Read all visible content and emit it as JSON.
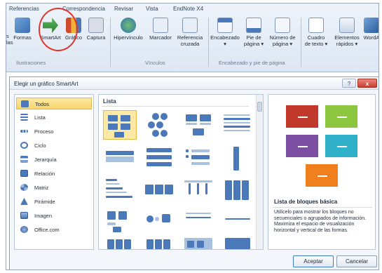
{
  "ribbon": {
    "tabs": [
      "Referencias",
      "Correspondencia",
      "Revisar",
      "Vista",
      "EndNote X4"
    ],
    "buttons": [
      {
        "label": "Formas",
        "label2": "",
        "icon": "shapes-icon"
      },
      {
        "label": "SmartArt",
        "label2": "",
        "icon": "smartart-icon"
      },
      {
        "label": "Gráfico",
        "label2": "",
        "icon": "chart-icon"
      },
      {
        "label": "Captura",
        "label2": "",
        "icon": "screenshot-icon"
      },
      {
        "label": "Hipervínculo",
        "label2": "",
        "icon": "hyperlink-icon"
      },
      {
        "label": "Marcador",
        "label2": "",
        "icon": "bookmark-icon"
      },
      {
        "label": "Referencia",
        "label2": "cruzada",
        "icon": "cross-reference-icon"
      },
      {
        "label": "Encabezado",
        "label2": "▾",
        "icon": "header-icon"
      },
      {
        "label": "Pie de",
        "label2": "página ▾",
        "icon": "footer-icon"
      },
      {
        "label": "Número de",
        "label2": "página ▾",
        "icon": "page-number-icon"
      },
      {
        "label": "Cuadro",
        "label2": "de texto ▾",
        "icon": "textbox-icon"
      },
      {
        "label": "Elementos",
        "label2": "rápidos ▾",
        "icon": "quick-parts-icon"
      },
      {
        "label": "WordA",
        "label2": "",
        "icon": "wordart-icon"
      }
    ],
    "left_fragments": [
      "s",
      "las"
    ],
    "groups": [
      "Ilustraciones",
      "Vínculos",
      "Encabezado y pie de página"
    ]
  },
  "dialog": {
    "title": "Elegir un gráfico SmartArt",
    "help": "?",
    "close": "x",
    "categories": [
      "Todos",
      "Lista",
      "Proceso",
      "Ciclo",
      "Jerarquía",
      "Relación",
      "Matriz",
      "Pirámide",
      "Imagen",
      "Office.com"
    ],
    "selected_category": "Todos",
    "gallery_header": "Lista",
    "preview_title": "Lista de bloques básica",
    "preview_desc": [
      "Utilícelo para mostrar los bloques no",
      "secuenciales o agrupados de información.",
      "Maximiza el espacio de visualización",
      "horizontal y vertical de las formas."
    ],
    "ok": "Aceptar",
    "cancel": "Cancelar"
  },
  "colors": {
    "preview_red": "#c0392b",
    "preview_green": "#8cc63e",
    "preview_purple": "#7c4fa3",
    "preview_teal": "#2fb1c9",
    "preview_orange": "#f0801e",
    "accent_blue": "#4b78b8",
    "selection_yellow": "#f8d46b",
    "annotation_red": "#e0352c"
  }
}
